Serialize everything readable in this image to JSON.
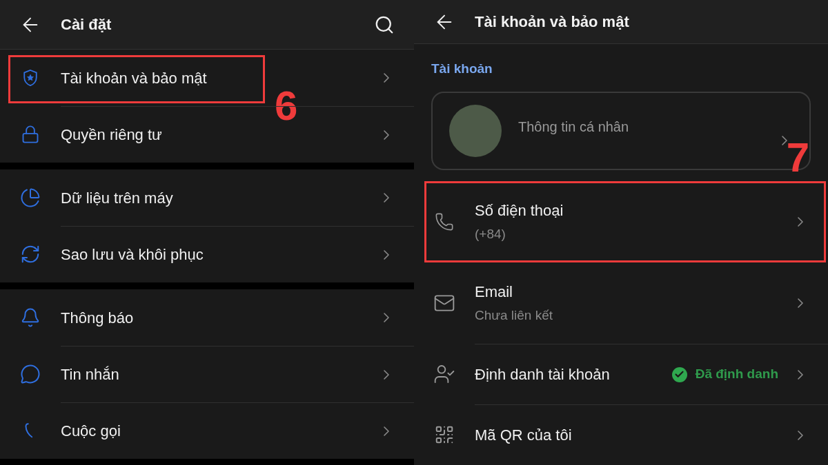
{
  "settings_screen": {
    "title": "Cài đặt",
    "sections": [
      [
        {
          "label": "Tài khoản và bảo mật",
          "highlighted": true,
          "annotation": "6"
        },
        {
          "label": "Quyền riêng tư",
          "highlighted": false
        }
      ],
      [
        {
          "label": "Dữ liệu trên máy",
          "highlighted": false
        },
        {
          "label": "Sao lưu và khôi phục",
          "highlighted": false
        }
      ],
      [
        {
          "label": "Thông báo",
          "highlighted": false
        },
        {
          "label": "Tin nhắn",
          "highlighted": false
        },
        {
          "label": "Cuộc gọi",
          "highlighted": false
        }
      ]
    ]
  },
  "account_screen": {
    "title": "Tài khoản và bảo mật",
    "section_label": "Tài khoản",
    "profile_card": {
      "label": "Thông tin cá nhân",
      "annotation": "7"
    },
    "items": [
      {
        "title": "Số điện thoại",
        "subtitle": "(+84)",
        "highlighted": true
      },
      {
        "title": "Email",
        "subtitle": "Chưa liên kết",
        "highlighted": false
      },
      {
        "title": "Định danh tài khoản",
        "status": {
          "text": "Đã định danh",
          "verified": true
        },
        "highlighted": false
      },
      {
        "title": "Mã QR của tôi",
        "highlighted": false
      }
    ]
  }
}
